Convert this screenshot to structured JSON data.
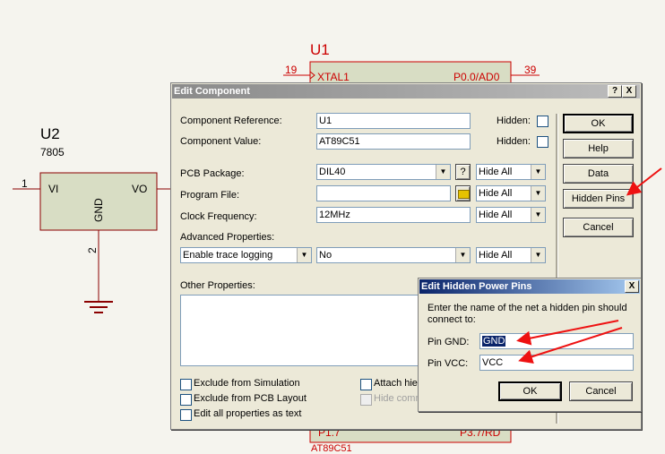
{
  "schematic": {
    "u1": {
      "ref": "U1",
      "pin_num_left": "19",
      "pin_name_left": "XTAL1",
      "pin_name_right": "P0.0/AD0",
      "pin_num_right": "39",
      "bottom_left": "P1.7",
      "bottom_right": "P3.7/RD",
      "bottom_value": "AT89C51"
    },
    "u2": {
      "ref": "U2",
      "value": "7805",
      "pin_in_num": "1",
      "pin_in_name": "VI",
      "pin_out_name": "VO",
      "pin_gnd_name": "GND",
      "pin_gnd_num": "2"
    },
    "colors": {
      "wire": "#8b0000",
      "pin": "#cc0000",
      "part_fill": "#d8ddc4"
    }
  },
  "edit_component": {
    "title": "Edit Component",
    "title_help": "?",
    "title_close": "X",
    "component_reference": {
      "label": "Component Reference:",
      "value": "U1",
      "hidden_label": "Hidden:"
    },
    "component_value": {
      "label": "Component Value:",
      "value": "AT89C51",
      "hidden_label": "Hidden:"
    },
    "pcb_package": {
      "label": "PCB Package:",
      "value": "DIL40",
      "help": "?",
      "visibility": "Hide All"
    },
    "program_file": {
      "label": "Program File:",
      "value": "",
      "visibility": "Hide All"
    },
    "clock_frequency": {
      "label": "Clock Frequency:",
      "value": "12MHz",
      "visibility": "Hide All"
    },
    "advanced_properties": {
      "label": "Advanced Properties:",
      "property": "Enable trace logging",
      "value": "No",
      "visibility": "Hide All"
    },
    "other_properties": {
      "label": "Other Properties:"
    },
    "checks": {
      "exclude_sim": "Exclude from Simulation",
      "exclude_pcb": "Exclude from PCB Layout",
      "edit_all": "Edit all properties as text",
      "attach": "Attach hie",
      "hide_common": "Hide comm"
    },
    "buttons": {
      "ok": "OK",
      "help": "Help",
      "data": "Data",
      "hidden_pins": "Hidden Pins",
      "cancel": "Cancel"
    }
  },
  "hidden_pins_dialog": {
    "title": "Edit Hidden Power Pins",
    "close": "X",
    "instruction": "Enter the name of the net a hidden pin should connect to:",
    "pin_gnd": {
      "label": "Pin GND:",
      "value": "GND"
    },
    "pin_vcc": {
      "label": "Pin VCC:",
      "value": "VCC"
    },
    "buttons": {
      "ok": "OK",
      "cancel": "Cancel"
    }
  },
  "annotation_color": "#ee1111"
}
